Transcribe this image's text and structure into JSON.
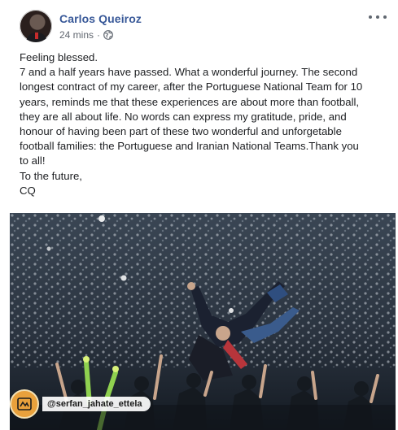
{
  "post": {
    "author": "Carlos Queiroz",
    "time": "24 mins",
    "dot": "·",
    "privacy_icon": "globe-icon",
    "more_icon": "more-options-icon",
    "lines": [
      "Feeling blessed.",
      "7 and a half years have passed. What a wonderful journey. The second",
      "longest contract of my career, after the Portuguese National Team for 10",
      "years, reminds me that these experiences are about more than football,",
      "they are all about life. No words can express my gratitude, pride, and",
      "honour of having been part of these two wonderful and unforgetable",
      "football families: the Portuguese and Iranian National Teams.Thank you",
      "to all!",
      "To the future,",
      "CQ"
    ]
  },
  "watermark": {
    "handle": "@serfan_jahate_ettela",
    "logo_icon": "channel-logo-icon"
  },
  "colors": {
    "author": "#385898",
    "text": "#1c1e21",
    "meta": "#616770"
  }
}
